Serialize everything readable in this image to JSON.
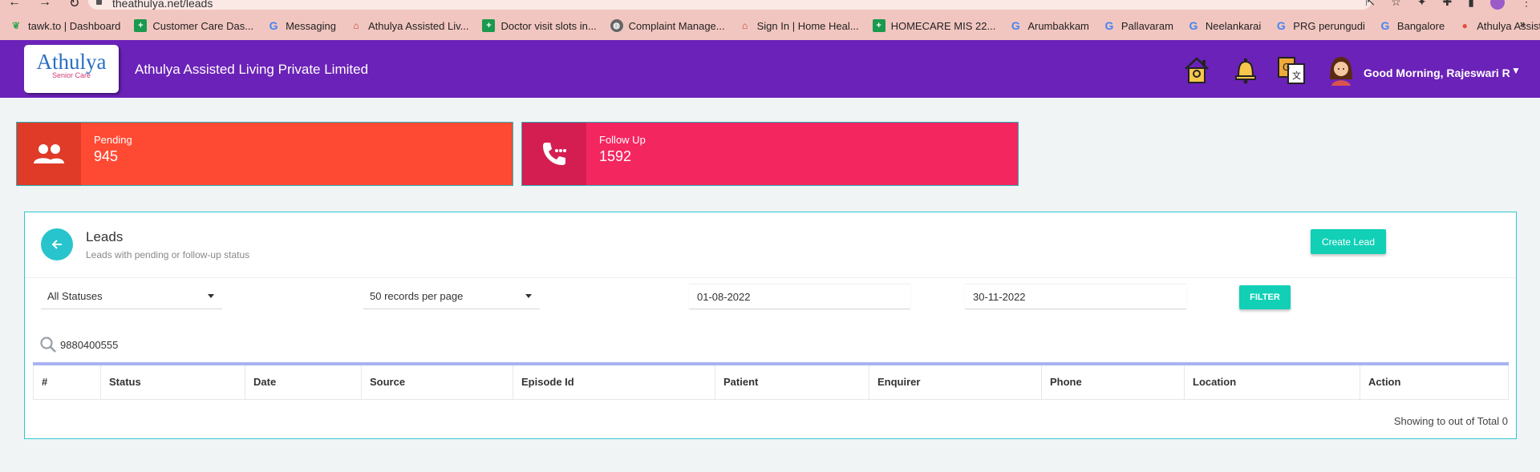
{
  "browser": {
    "url": "theathulya.net/leads",
    "bookmarks": [
      {
        "label": "tawk.to | Dashboard",
        "icon": "leaf-icon"
      },
      {
        "label": "Customer Care Das...",
        "icon": "sheets-icon"
      },
      {
        "label": "Messaging",
        "icon": "google-icon"
      },
      {
        "label": "Athulya Assisted Liv...",
        "icon": "house-icon"
      },
      {
        "label": "Doctor visit slots in...",
        "icon": "sheets-icon"
      },
      {
        "label": "Complaint Manage...",
        "icon": "globe-icon"
      },
      {
        "label": "Sign In | Home Heal...",
        "icon": "house-icon"
      },
      {
        "label": "HOMECARE MIS 22...",
        "icon": "sheets-icon"
      },
      {
        "label": "Arumbakkam",
        "icon": "google-icon"
      },
      {
        "label": "Pallavaram",
        "icon": "google-icon"
      },
      {
        "label": "Neelankarai",
        "icon": "google-icon"
      },
      {
        "label": "PRG perungudi",
        "icon": "google-icon"
      },
      {
        "label": "Bangalore",
        "icon": "google-icon"
      },
      {
        "label": "Athulya Assisted Liv...",
        "icon": "map-pin-icon"
      }
    ],
    "more": "»"
  },
  "header": {
    "logo_text": "Athulya",
    "logo_sub": "Senior Care",
    "company": "Athulya Assisted Living Private Limited",
    "greeting": "Good Morning, Rajeswari R",
    "caret": "▼"
  },
  "cards": {
    "pending": {
      "label": "Pending",
      "value": "945",
      "color": "#ff4a33"
    },
    "follow_up": {
      "label": "Follow Up",
      "value": "1592",
      "color": "#f42660"
    }
  },
  "leads": {
    "title": "Leads",
    "subtitle": "Leads with pending or follow-up status",
    "create_label": "Create Lead",
    "status_select": "All Statuses",
    "records_select": "50 records per page",
    "date_from": "01-08-2022",
    "date_to": "30-11-2022",
    "filter_label": "FILTER",
    "search_value": "9880400555",
    "columns": [
      "#",
      "Status",
      "Date",
      "Source",
      "Episode Id",
      "Patient",
      "Enquirer",
      "Phone",
      "Location",
      "Action"
    ],
    "showing": "Showing to out of Total 0"
  },
  "colors": {
    "header_bg": "#6b22b8",
    "accent": "#11d0b6",
    "panel_border": "#30c7cf"
  }
}
